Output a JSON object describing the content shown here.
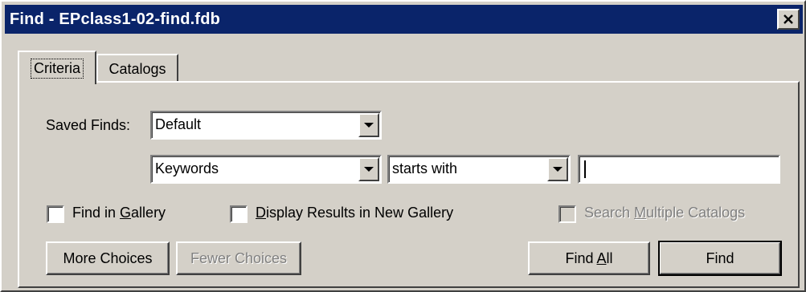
{
  "window": {
    "title": "Find - EPclass1-02-find.fdb",
    "close_icon": "close-icon"
  },
  "tabs": [
    {
      "label": "Criteria",
      "active": true
    },
    {
      "label": "Catalogs",
      "active": false
    }
  ],
  "criteria": {
    "saved_finds_label": "Saved Finds:",
    "saved_finds_value": "Default",
    "field_value": "Keywords",
    "operator_value": "starts with",
    "search_text_value": ""
  },
  "options": {
    "find_in_gallery": {
      "prefix": "Find in ",
      "accel": "G",
      "suffix": "allery",
      "checked": false
    },
    "display_results": {
      "prefix": "",
      "accel": "D",
      "suffix": "isplay Results in New Gallery",
      "checked": false
    },
    "search_multiple": {
      "prefix": "Search ",
      "accel": "M",
      "suffix": "ultiple Catalogs",
      "checked": false,
      "enabled": false
    }
  },
  "buttons": {
    "more_choices": "More Choices",
    "fewer_choices": "Fewer Choices",
    "find_all_prefix": "Find ",
    "find_all_accel": "A",
    "find_all_suffix": "ll",
    "find": "Find"
  },
  "colors": {
    "titlebar": "#0a246a",
    "face": "#d4d0c8",
    "disabled_text": "#808080"
  }
}
